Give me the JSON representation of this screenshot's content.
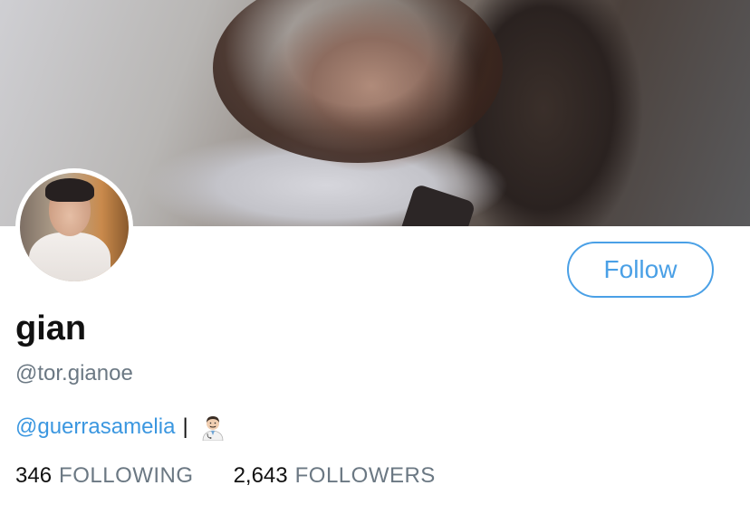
{
  "profile": {
    "display_name": "gian",
    "handle": "@tor.gianoe",
    "bio_mention": "@guerrasamelia",
    "bio_separator": "|",
    "bio_emoji": "man-health-worker-icon"
  },
  "actions": {
    "follow_label": "Follow"
  },
  "stats": {
    "following_count": "346",
    "following_label": "FOLLOWING",
    "followers_count": "2,643",
    "followers_label": "FOLLOWERS"
  },
  "colors": {
    "accent": "#4aa0e6",
    "mention": "#3b97e0",
    "muted": "#6b7883",
    "text": "#111111"
  }
}
